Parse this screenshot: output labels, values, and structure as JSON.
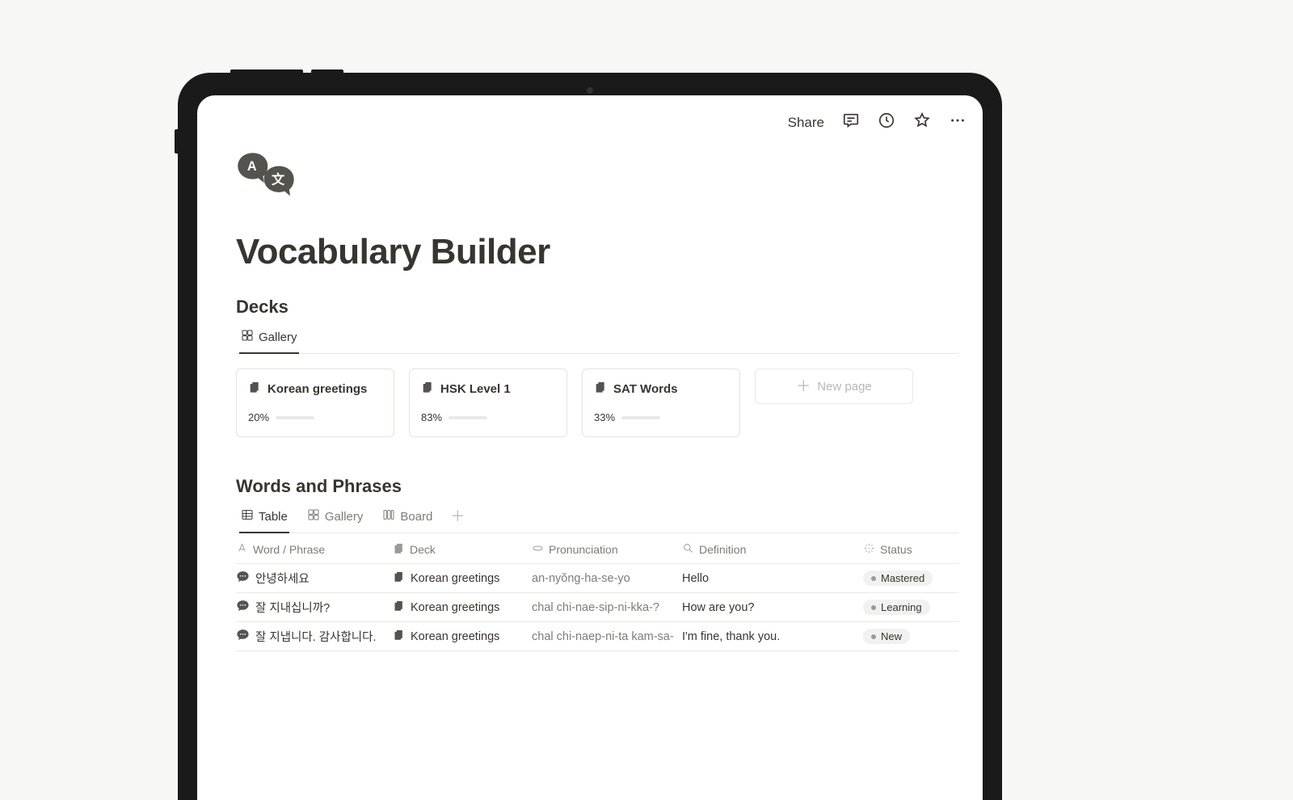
{
  "topbar": {
    "share": "Share"
  },
  "page": {
    "title": "Vocabulary Builder"
  },
  "decks_section": {
    "heading": "Decks",
    "tabs": {
      "gallery": "Gallery"
    },
    "cards": [
      {
        "title": "Korean greetings",
        "percent_label": "20%",
        "percent": 20
      },
      {
        "title": "HSK Level 1",
        "percent_label": "83%",
        "percent": 83
      },
      {
        "title": "SAT Words",
        "percent_label": "33%",
        "percent": 33
      }
    ],
    "new_page": "New page"
  },
  "words_section": {
    "heading": "Words and Phrases",
    "tabs": {
      "table": "Table",
      "gallery": "Gallery",
      "board": "Board"
    },
    "columns": {
      "word": "Word / Phrase",
      "deck": "Deck",
      "pron": "Pronunciation",
      "def": "Definition",
      "status": "Status"
    },
    "rows": [
      {
        "word": "안녕하세요",
        "deck": "Korean greetings",
        "pron": "an-nyŏng-ha-se-yo",
        "def": "Hello",
        "status": "Mastered"
      },
      {
        "word": "잘 지내십니까?",
        "deck": "Korean greetings",
        "pron": "chal chi-nae-sip-ni-kka-?",
        "def": "How are you?",
        "status": "Learning"
      },
      {
        "word": "잘 지냅니다. 감사합니다.",
        "deck": "Korean greetings",
        "pron": "chal chi-naep-ni-ta kam-sa-",
        "def": "I'm fine, thank you.",
        "status": "New"
      }
    ]
  }
}
